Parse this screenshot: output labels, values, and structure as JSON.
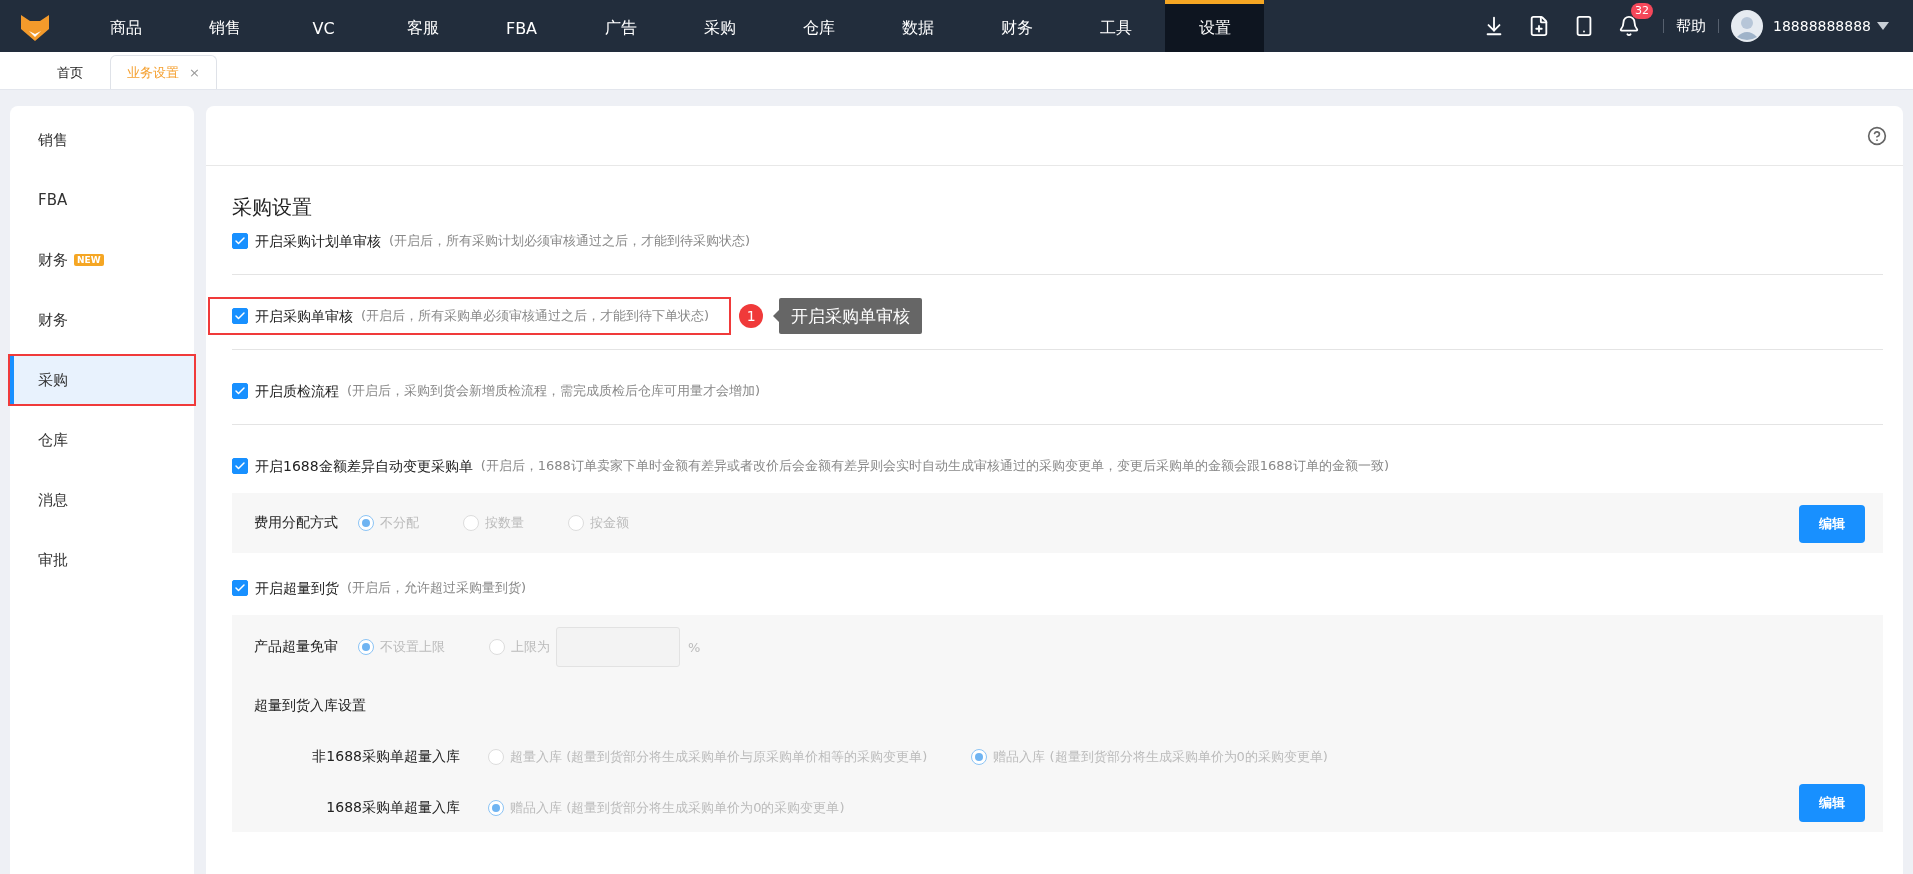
{
  "nav": {
    "items": [
      {
        "label": "商品",
        "selected": false
      },
      {
        "label": "销售",
        "selected": false
      },
      {
        "label": "VC",
        "selected": false
      },
      {
        "label": "客服",
        "selected": false
      },
      {
        "label": "FBA",
        "selected": false
      },
      {
        "label": "广告",
        "selected": false
      },
      {
        "label": "采购",
        "selected": false
      },
      {
        "label": "仓库",
        "selected": false
      },
      {
        "label": "数据",
        "selected": false
      },
      {
        "label": "财务",
        "selected": false
      },
      {
        "label": "工具",
        "selected": false
      },
      {
        "label": "设置",
        "selected": true
      }
    ],
    "notification_count": "32",
    "help": "帮助",
    "user": "18888888888"
  },
  "tabs": [
    {
      "label": "首页",
      "selected": false
    },
    {
      "label": "业务设置",
      "selected": true,
      "close": "×"
    }
  ],
  "sidebar": {
    "items": [
      {
        "label": "销售",
        "selected": false,
        "highlighted": false
      },
      {
        "label": "FBA",
        "selected": false,
        "highlighted": false
      },
      {
        "label": "财务",
        "badge": "NEW",
        "selected": false,
        "highlighted": false
      },
      {
        "label": "财务",
        "selected": false,
        "highlighted": false
      },
      {
        "label": "采购",
        "selected": true,
        "highlighted": true
      },
      {
        "label": "仓库",
        "selected": false,
        "highlighted": false
      },
      {
        "label": "消息",
        "selected": false,
        "highlighted": false
      },
      {
        "label": "审批",
        "selected": false,
        "highlighted": false
      }
    ]
  },
  "content": {
    "title": "采购设置",
    "settings": [
      {
        "label": "开启采购计划单审核",
        "hint": "(开启后，所有采购计划必须审核通过之后，才能到待采购状态)",
        "checked": true,
        "highlighted": false
      },
      {
        "label": "开启采购单审核",
        "hint": "(开启后，所有采购单必须审核通过之后，才能到待下单状态)",
        "checked": true,
        "highlighted": true,
        "annotation": {
          "number": "1",
          "text": "开启采购单审核"
        }
      },
      {
        "label": "开启质检流程",
        "hint": "(开启后，采购到货会新增质检流程，需完成质检后仓库可用量才会增加)",
        "checked": true,
        "highlighted": false
      },
      {
        "label": "开启1688金额差异自动变更采购单",
        "hint": "(开启后，1688订单卖家下单时金额有差异或者改价后会金额有差异则会实时自动生成审核通过的采购变更单，变更后采购单的金额会跟1688订单的金额一致)",
        "checked": true,
        "highlighted": false,
        "panel": {
          "rows": [
            {
              "kind": "radios",
              "label": "费用分配方式",
              "options": [
                {
                  "label": "不分配",
                  "selected": true
                },
                {
                  "label": "按数量",
                  "selected": false
                },
                {
                  "label": "按金额",
                  "selected": false
                }
              ]
            }
          ],
          "button": "编辑"
        }
      },
      {
        "label": "开启超量到货",
        "hint": "(开启后，允许超过采购量到货)",
        "checked": true,
        "highlighted": false,
        "panel": {
          "rows": [
            {
              "kind": "radios",
              "label": "产品超量免审",
              "options": [
                {
                  "label": "不设置上限",
                  "selected": true
                },
                {
                  "label": "上限为",
                  "selected": false
                }
              ],
              "field_suffix": "%"
            },
            {
              "kind": "heading",
              "label": "超量到货入库设置"
            },
            {
              "kind": "sub",
              "label": "非1688采购单超量入库",
              "options": [
                {
                  "label": "超量入库",
                  "hint": "(超量到货部分将生成采购单价与原采购单价相等的采购变更单)",
                  "selected": false
                },
                {
                  "label": "赠品入库",
                  "hint": "(超量到货部分将生成采购单价为0的采购变更单)",
                  "selected": true
                }
              ]
            },
            {
              "kind": "sub",
              "label": "1688采购单超量入库",
              "options": [
                {
                  "label": "赠品入库",
                  "hint": "(超量到货部分将生成采购单价为0的采购变更单)",
                  "selected": true
                }
              ]
            }
          ],
          "button": "编辑"
        }
      }
    ]
  }
}
